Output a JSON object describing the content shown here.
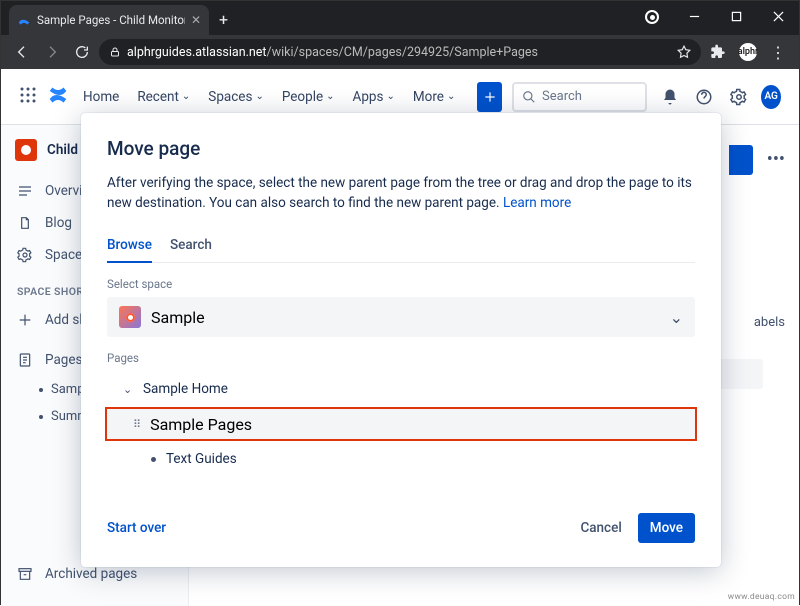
{
  "browser": {
    "tab_title": "Sample Pages - Child Monitoring",
    "url_host": "alphrguides.atlassian.net",
    "url_path": "/wiki/spaces/CM/pages/294925/Sample+Pages",
    "ext_badge": "alphr"
  },
  "appbar": {
    "home": "Home",
    "recent": "Recent",
    "spaces": "Spaces",
    "people": "People",
    "apps": "Apps",
    "more": "More",
    "search_placeholder": "Search",
    "avatar": "AG"
  },
  "sidebar": {
    "space_name": "Child M",
    "overview": "Overvi",
    "blog": "Blog",
    "space_settings": "Space",
    "shortcuts_header": "Space shortc",
    "add_shortcut": "Add sh",
    "pages": "Pages",
    "sub_sample": "Sampl",
    "sub_summary": "Summ",
    "archived": "Archived pages"
  },
  "peek": {
    "labels": "abels",
    "tag": "◆"
  },
  "modal": {
    "title": "Move page",
    "desc1": "After verifying the space, select the new parent page from the tree or drag and drop the page to its new destination. You can also search to find the new parent page. ",
    "learn_more": "Learn more",
    "tab_browse": "Browse",
    "tab_search": "Search",
    "select_space": "Select space",
    "selected_space": "Sample",
    "pages_label": "Pages",
    "tree_root": "Sample Home",
    "tree_selected": "Sample Pages",
    "tree_child": "Text Guides",
    "start_over": "Start over",
    "cancel": "Cancel",
    "move": "Move"
  },
  "watermark": "www.deuaq.com"
}
